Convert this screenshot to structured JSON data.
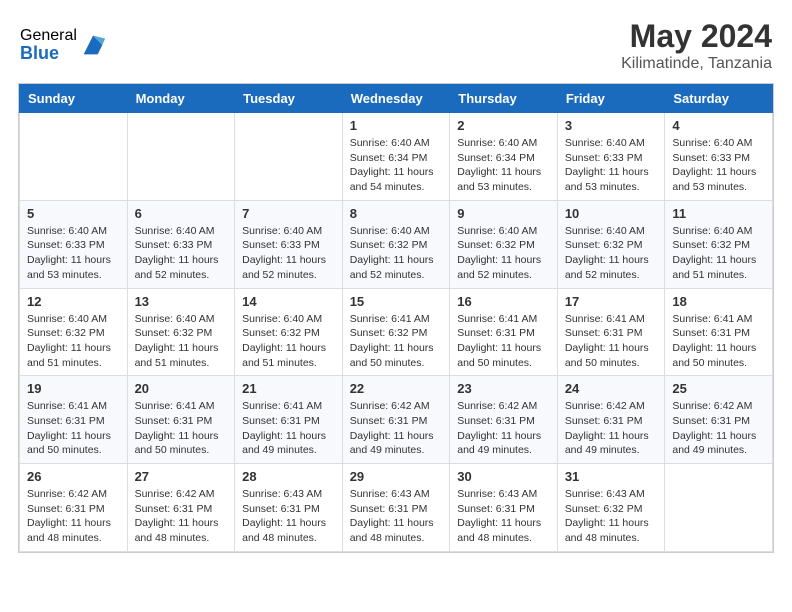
{
  "header": {
    "logo_general": "General",
    "logo_blue": "Blue",
    "month_title": "May 2024",
    "location": "Kilimatinde, Tanzania"
  },
  "calendar": {
    "days_of_week": [
      "Sunday",
      "Monday",
      "Tuesday",
      "Wednesday",
      "Thursday",
      "Friday",
      "Saturday"
    ],
    "weeks": [
      [
        {
          "day": "",
          "info": ""
        },
        {
          "day": "",
          "info": ""
        },
        {
          "day": "",
          "info": ""
        },
        {
          "day": "1",
          "info": "Sunrise: 6:40 AM\nSunset: 6:34 PM\nDaylight: 11 hours\nand 54 minutes."
        },
        {
          "day": "2",
          "info": "Sunrise: 6:40 AM\nSunset: 6:34 PM\nDaylight: 11 hours\nand 53 minutes."
        },
        {
          "day": "3",
          "info": "Sunrise: 6:40 AM\nSunset: 6:33 PM\nDaylight: 11 hours\nand 53 minutes."
        },
        {
          "day": "4",
          "info": "Sunrise: 6:40 AM\nSunset: 6:33 PM\nDaylight: 11 hours\nand 53 minutes."
        }
      ],
      [
        {
          "day": "5",
          "info": "Sunrise: 6:40 AM\nSunset: 6:33 PM\nDaylight: 11 hours\nand 53 minutes."
        },
        {
          "day": "6",
          "info": "Sunrise: 6:40 AM\nSunset: 6:33 PM\nDaylight: 11 hours\nand 52 minutes."
        },
        {
          "day": "7",
          "info": "Sunrise: 6:40 AM\nSunset: 6:33 PM\nDaylight: 11 hours\nand 52 minutes."
        },
        {
          "day": "8",
          "info": "Sunrise: 6:40 AM\nSunset: 6:32 PM\nDaylight: 11 hours\nand 52 minutes."
        },
        {
          "day": "9",
          "info": "Sunrise: 6:40 AM\nSunset: 6:32 PM\nDaylight: 11 hours\nand 52 minutes."
        },
        {
          "day": "10",
          "info": "Sunrise: 6:40 AM\nSunset: 6:32 PM\nDaylight: 11 hours\nand 52 minutes."
        },
        {
          "day": "11",
          "info": "Sunrise: 6:40 AM\nSunset: 6:32 PM\nDaylight: 11 hours\nand 51 minutes."
        }
      ],
      [
        {
          "day": "12",
          "info": "Sunrise: 6:40 AM\nSunset: 6:32 PM\nDaylight: 11 hours\nand 51 minutes."
        },
        {
          "day": "13",
          "info": "Sunrise: 6:40 AM\nSunset: 6:32 PM\nDaylight: 11 hours\nand 51 minutes."
        },
        {
          "day": "14",
          "info": "Sunrise: 6:40 AM\nSunset: 6:32 PM\nDaylight: 11 hours\nand 51 minutes."
        },
        {
          "day": "15",
          "info": "Sunrise: 6:41 AM\nSunset: 6:32 PM\nDaylight: 11 hours\nand 50 minutes."
        },
        {
          "day": "16",
          "info": "Sunrise: 6:41 AM\nSunset: 6:31 PM\nDaylight: 11 hours\nand 50 minutes."
        },
        {
          "day": "17",
          "info": "Sunrise: 6:41 AM\nSunset: 6:31 PM\nDaylight: 11 hours\nand 50 minutes."
        },
        {
          "day": "18",
          "info": "Sunrise: 6:41 AM\nSunset: 6:31 PM\nDaylight: 11 hours\nand 50 minutes."
        }
      ],
      [
        {
          "day": "19",
          "info": "Sunrise: 6:41 AM\nSunset: 6:31 PM\nDaylight: 11 hours\nand 50 minutes."
        },
        {
          "day": "20",
          "info": "Sunrise: 6:41 AM\nSunset: 6:31 PM\nDaylight: 11 hours\nand 50 minutes."
        },
        {
          "day": "21",
          "info": "Sunrise: 6:41 AM\nSunset: 6:31 PM\nDaylight: 11 hours\nand 49 minutes."
        },
        {
          "day": "22",
          "info": "Sunrise: 6:42 AM\nSunset: 6:31 PM\nDaylight: 11 hours\nand 49 minutes."
        },
        {
          "day": "23",
          "info": "Sunrise: 6:42 AM\nSunset: 6:31 PM\nDaylight: 11 hours\nand 49 minutes."
        },
        {
          "day": "24",
          "info": "Sunrise: 6:42 AM\nSunset: 6:31 PM\nDaylight: 11 hours\nand 49 minutes."
        },
        {
          "day": "25",
          "info": "Sunrise: 6:42 AM\nSunset: 6:31 PM\nDaylight: 11 hours\nand 49 minutes."
        }
      ],
      [
        {
          "day": "26",
          "info": "Sunrise: 6:42 AM\nSunset: 6:31 PM\nDaylight: 11 hours\nand 48 minutes."
        },
        {
          "day": "27",
          "info": "Sunrise: 6:42 AM\nSunset: 6:31 PM\nDaylight: 11 hours\nand 48 minutes."
        },
        {
          "day": "28",
          "info": "Sunrise: 6:43 AM\nSunset: 6:31 PM\nDaylight: 11 hours\nand 48 minutes."
        },
        {
          "day": "29",
          "info": "Sunrise: 6:43 AM\nSunset: 6:31 PM\nDaylight: 11 hours\nand 48 minutes."
        },
        {
          "day": "30",
          "info": "Sunrise: 6:43 AM\nSunset: 6:31 PM\nDaylight: 11 hours\nand 48 minutes."
        },
        {
          "day": "31",
          "info": "Sunrise: 6:43 AM\nSunset: 6:32 PM\nDaylight: 11 hours\nand 48 minutes."
        },
        {
          "day": "",
          "info": ""
        }
      ]
    ]
  }
}
